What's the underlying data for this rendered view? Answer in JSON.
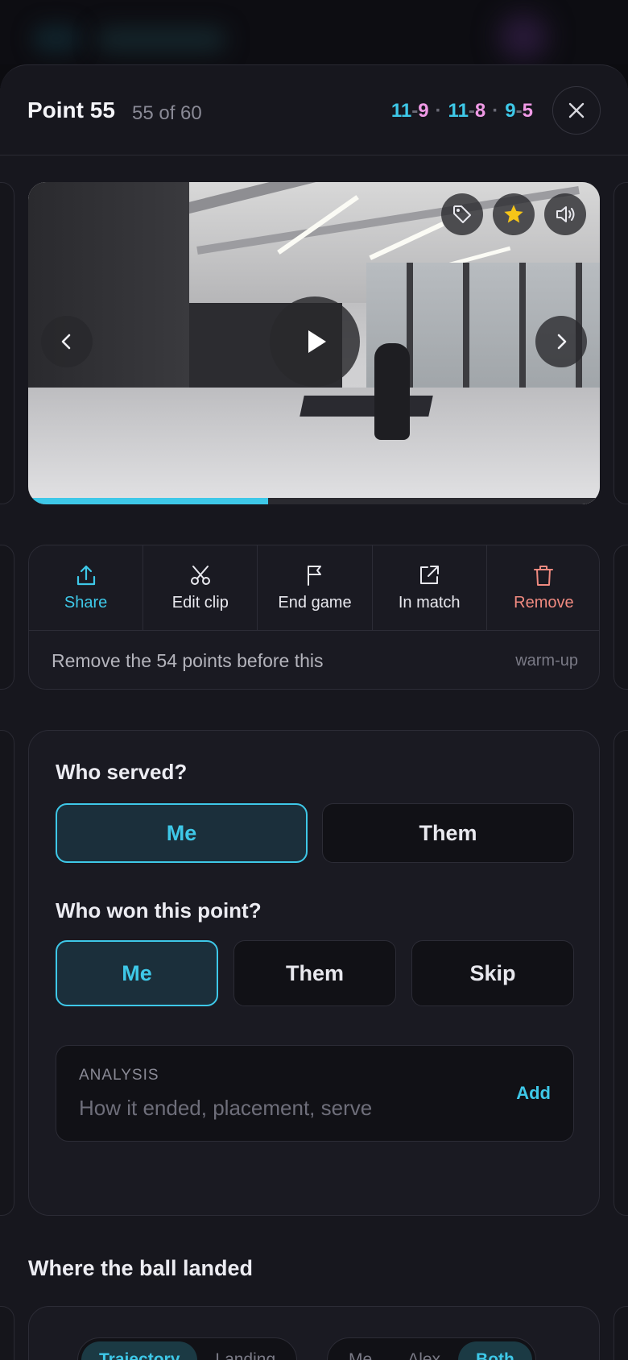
{
  "header": {
    "title": "Point 55",
    "subtitle": "55 of 60",
    "games": [
      {
        "me": "11",
        "them": "9"
      },
      {
        "me": "11",
        "them": "8"
      },
      {
        "me": "9",
        "them": "5"
      }
    ],
    "close_icon": "close-icon"
  },
  "video": {
    "progress_fraction": 0.42,
    "tag_icon": "tag-icon",
    "star_icon": "star-icon",
    "sound_icon": "volume-icon",
    "play_icon": "play-icon",
    "prev_icon": "chevron-left-icon",
    "next_icon": "chevron-right-icon",
    "colors": {
      "progress": "#3ec8e8",
      "star": "#f5c518"
    }
  },
  "actions": {
    "share": "Share",
    "edit_clip": "Edit clip",
    "end_game": "End game",
    "in_match": "In match",
    "remove": "Remove"
  },
  "warmup": {
    "text": "Remove the 54 points before this",
    "tag": "warm-up"
  },
  "form": {
    "served_question": "Who served?",
    "served_options": [
      "Me",
      "Them"
    ],
    "served_selected": "Me",
    "won_question": "Who won this point?",
    "won_options": [
      "Me",
      "Them",
      "Skip"
    ],
    "won_selected": "Me",
    "analysis_caption": "ANALYSIS",
    "analysis_placeholder": "How it ended, placement, serve",
    "analysis_add": "Add"
  },
  "landing": {
    "title": "Where the ball landed",
    "view_tabs": [
      "Trajectory",
      "Landing"
    ],
    "view_selected": "Trajectory",
    "player_tabs": [
      "Me",
      "Alex",
      "Both"
    ],
    "player_selected": "Both"
  },
  "theme": {
    "accent": "#3ec8e8",
    "opponent": "#f09ae6",
    "danger": "#f08a80"
  }
}
